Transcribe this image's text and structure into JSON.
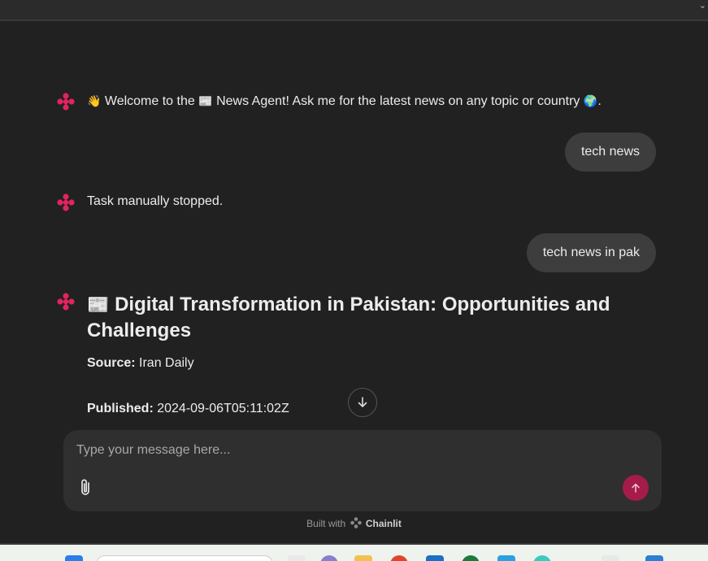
{
  "chat": {
    "welcome": {
      "wave": "👋",
      "text_before": " Welcome to the ",
      "paper": "📰",
      "text_after": " News Agent! Ask me for the latest news on any topic or country ",
      "globe": "🌍",
      "end": "."
    },
    "user_msg_1": "tech news",
    "stopped": "Task manually stopped.",
    "user_msg_2": "tech news in pak",
    "article": {
      "emoji": "📰",
      "title": "Digital Transformation in Pakistan: Opportunities and Challenges",
      "source_label": "Source:",
      "source_value": "Iran Daily",
      "published_label": "Published:",
      "published_value": "2024-09-06T05:11:02Z"
    }
  },
  "composer": {
    "placeholder": "Type your message here..."
  },
  "footer": {
    "prefix": "Built with",
    "brand": "Chainlit"
  },
  "colors": {
    "background": "#212121",
    "bubble": "#3d3d3d",
    "accent": "#e0245e",
    "send": "#a51c4a"
  }
}
